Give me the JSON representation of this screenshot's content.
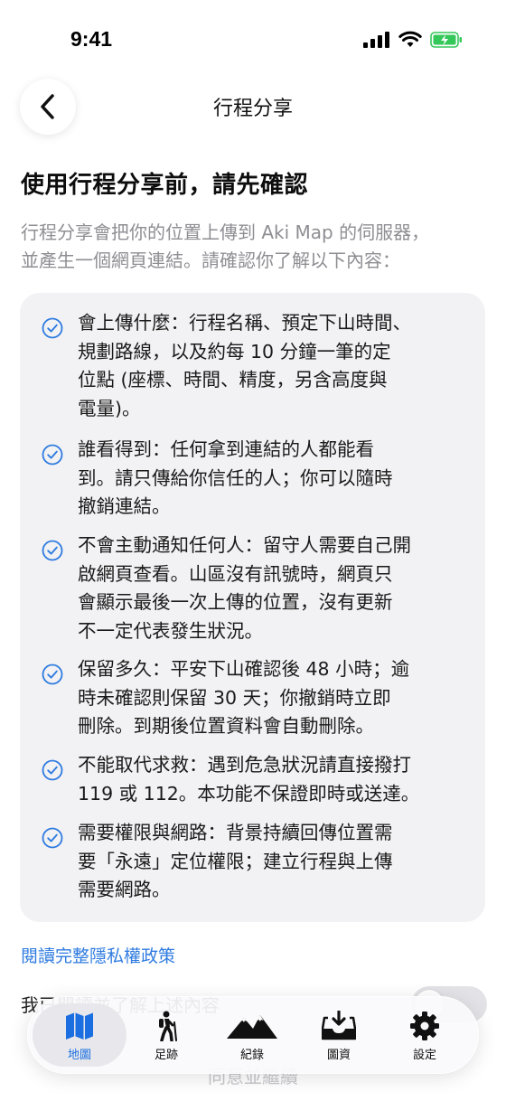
{
  "status_bar": {
    "time": "9:41"
  },
  "nav": {
    "title": "行程分享"
  },
  "section_title": "使用行程分享前，請先確認",
  "intro_lines": [
    "行程分享會把你的位置上傳到 Aki Map 的伺服器，",
    "並產生一個網頁連結。請確認你了解以下內容："
  ],
  "items": [
    {
      "lines": [
        "會上傳什麼：行程名稱、預定下山時間、",
        "規劃路線，以及約每 10 分鐘一筆的定",
        "位點 (座標、時間、精度，另含高度與",
        "電量)。"
      ]
    },
    {
      "lines": [
        "誰看得到：任何拿到連結的人都能看",
        "到。請只傳給你信任的人；你可以隨時",
        "撤銷連結。"
      ]
    },
    {
      "lines": [
        "不會主動通知任何人：留守人需要自己開",
        "啟網頁查看。山區沒有訊號時，網頁只",
        "會顯示最後一次上傳的位置，沒有更新",
        "不一定代表發生狀況。"
      ]
    },
    {
      "lines": [
        "保留多久：平安下山確認後 48 小時；逾",
        "時未確認則保留 30 天；你撤銷時立即",
        "刪除。到期後位置資料會自動刪除。"
      ]
    },
    {
      "lines": [
        "不能取代求救：遇到危急狀況請直接撥打",
        "119 或 112。本功能不保證即時或送達。"
      ]
    },
    {
      "lines": [
        "需要權限與網路：背景持續回傳位置需",
        "要「永遠」定位權限；建立行程與上傳",
        "需要網路。"
      ]
    }
  ],
  "privacy_link": "閱讀完整隱私權政策",
  "agree_label": "我已閱讀並了解上述內容",
  "agree_toggle": {
    "on": false
  },
  "confirm_button": "同意並繼續",
  "tabs": [
    {
      "label": "地圖",
      "icon": "map-icon",
      "active": true
    },
    {
      "label": "足跡",
      "icon": "hiker-icon",
      "active": false
    },
    {
      "label": "紀錄",
      "icon": "mountains-icon",
      "active": false
    },
    {
      "label": "圖資",
      "icon": "tray-download-icon",
      "active": false
    },
    {
      "label": "設定",
      "icon": "gear-icon",
      "active": false
    }
  ],
  "colors": {
    "accent": "#2f7be0",
    "active_tab": "#1b6fe0",
    "battery": "#34c759",
    "card_bg": "#f2f2f4"
  }
}
